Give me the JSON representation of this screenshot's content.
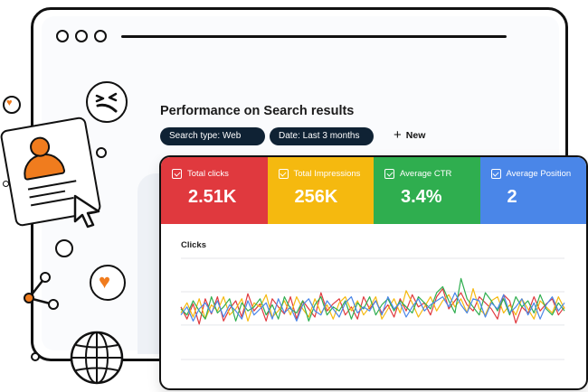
{
  "page": {
    "title": "Performance on Search results"
  },
  "filters": {
    "search_type": "Search type: Web",
    "date": "Date: Last 3 months",
    "new_label": "New"
  },
  "metrics": [
    {
      "label": "Total clicks",
      "value": "2.51K",
      "color": "#E0393E"
    },
    {
      "label": "Total Impressions",
      "value": "256K",
      "color": "#F5B90F"
    },
    {
      "label": "Average CTR",
      "value": "3.4%",
      "color": "#2FAE4F"
    },
    {
      "label": "Average Position",
      "value": "2",
      "color": "#4A86E8"
    }
  ],
  "chart_data": {
    "type": "line",
    "title": "Clicks",
    "xlabel": "",
    "ylabel": "",
    "grid": true,
    "ylim": [
      0,
      100
    ],
    "series": [
      {
        "color": "#E0393E",
        "values": [
          52,
          40,
          55,
          35,
          60,
          45,
          62,
          38,
          50,
          58,
          42,
          65,
          48,
          55,
          38,
          60,
          52,
          45,
          62,
          40,
          58,
          50,
          42,
          66,
          48,
          55,
          60,
          44,
          52,
          40,
          62,
          50,
          58,
          46,
          54,
          42,
          60,
          48,
          64,
          52,
          56,
          44,
          62,
          70,
          50,
          58,
          66,
          54,
          48,
          62,
          56,
          50,
          40,
          64,
          58,
          36,
          52,
          46,
          62,
          48,
          55,
          60,
          44,
          52
        ]
      },
      {
        "color": "#F5B90F",
        "values": [
          46,
          56,
          42,
          60,
          40,
          54,
          48,
          62,
          44,
          50,
          60,
          38,
          56,
          52,
          64,
          42,
          48,
          58,
          44,
          62,
          50,
          42,
          60,
          46,
          54,
          40,
          56,
          62,
          48,
          58,
          44,
          52,
          62,
          40,
          50,
          60,
          46,
          68,
          56,
          42,
          52,
          62,
          48,
          58,
          64,
          52,
          60,
          46,
          70,
          50,
          44,
          58,
          62,
          46,
          54,
          44,
          60,
          50,
          40,
          58,
          52,
          46,
          62,
          50
        ]
      },
      {
        "color": "#2FAE4F",
        "values": [
          50,
          44,
          58,
          48,
          40,
          62,
          46,
          52,
          60,
          38,
          56,
          48,
          52,
          60,
          44,
          54,
          40,
          62,
          50,
          46,
          58,
          38,
          54,
          62,
          44,
          52,
          48,
          58,
          40,
          56,
          50,
          62,
          44,
          54,
          60,
          48,
          58,
          52,
          46,
          62,
          56,
          50,
          66,
          72,
          58,
          46,
          80,
          60,
          52,
          44,
          66,
          58,
          48,
          60,
          44,
          62,
          52,
          58,
          46,
          64,
          50,
          44,
          56,
          48
        ]
      },
      {
        "color": "#4A86E8",
        "values": [
          44,
          52,
          38,
          50,
          56,
          46,
          58,
          42,
          54,
          48,
          40,
          58,
          44,
          50,
          56,
          40,
          60,
          46,
          52,
          38,
          54,
          60,
          48,
          44,
          58,
          50,
          42,
          56,
          62,
          46,
          52,
          48,
          58,
          44,
          62,
          50,
          56,
          42,
          52,
          60,
          48,
          54,
          58,
          62,
          52,
          66,
          54,
          46,
          60,
          58,
          42,
          56,
          50,
          64,
          46,
          52,
          60,
          44,
          56,
          40,
          54,
          62,
          48,
          56
        ]
      }
    ]
  },
  "icons": {
    "checkbox": "check-icon",
    "plus": "plus-icon",
    "heart": "heart-icon",
    "cursor": "cursor-icon",
    "share": "share-icon",
    "globe": "globe-icon"
  }
}
